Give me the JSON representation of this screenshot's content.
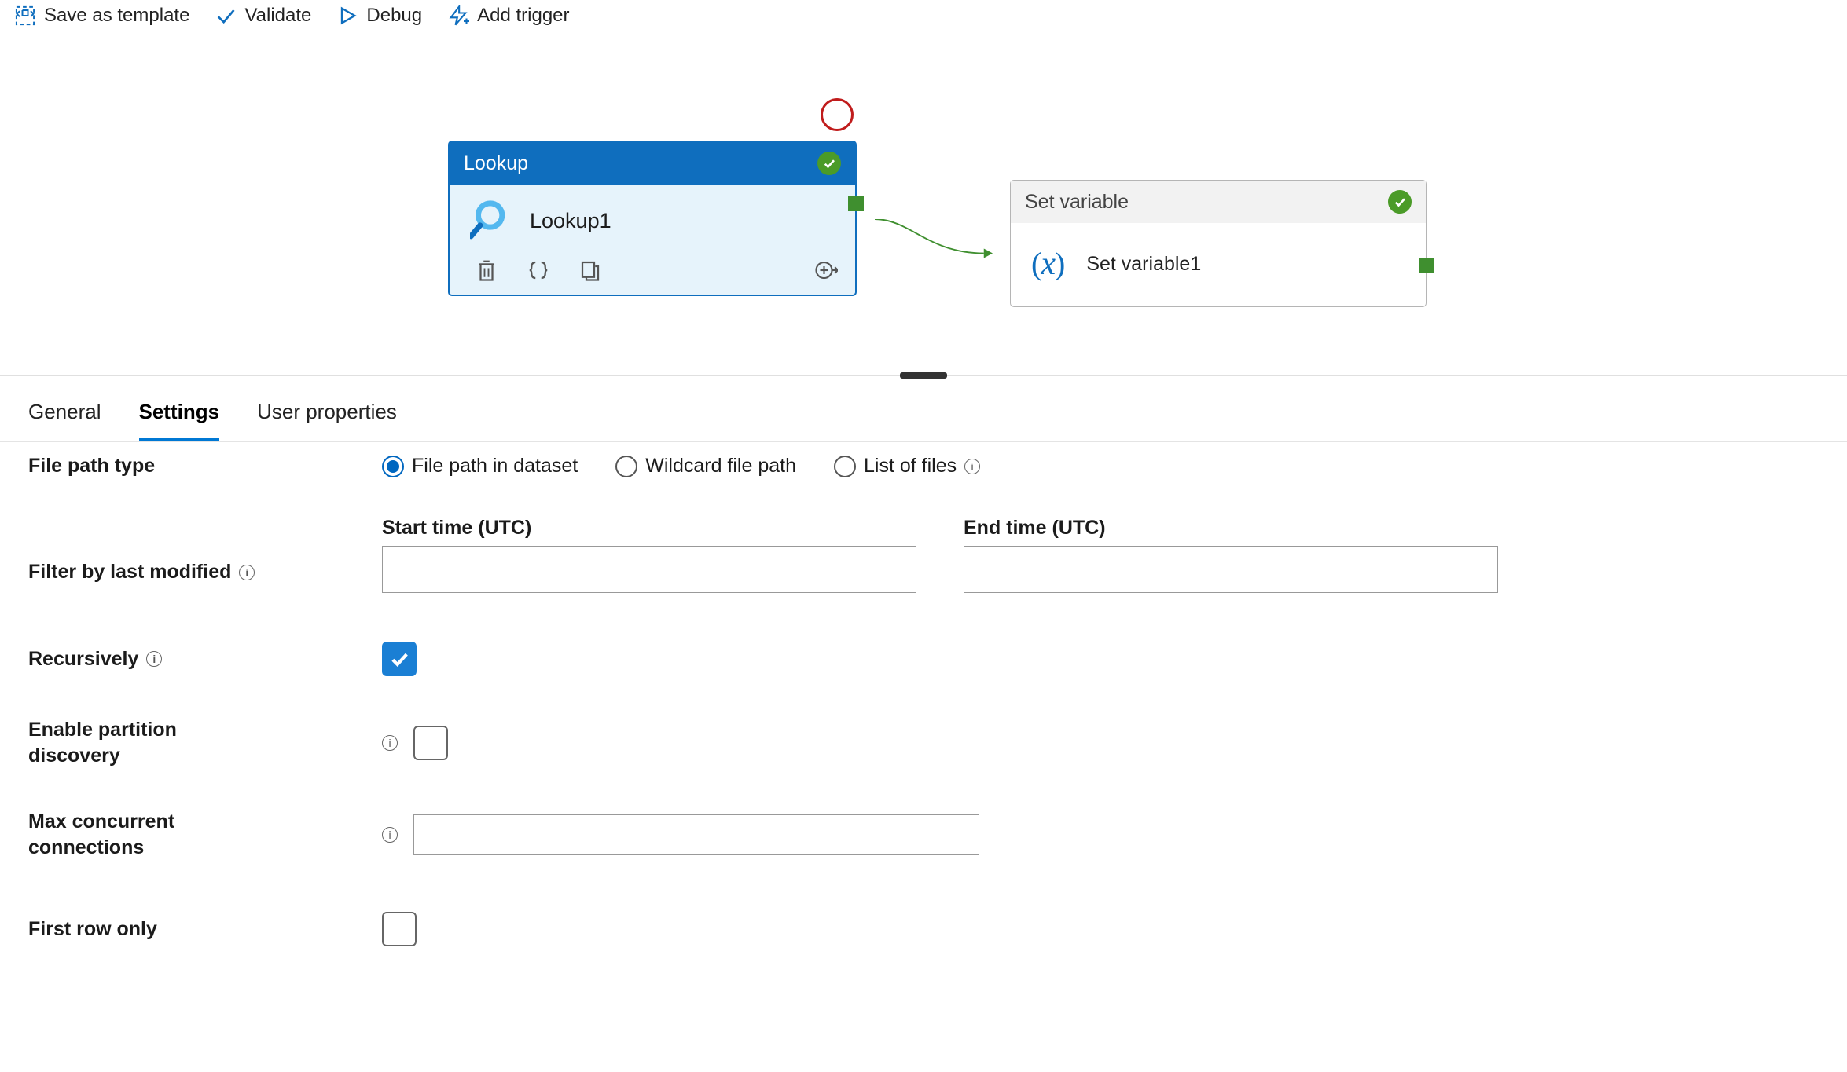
{
  "toolbar": {
    "save_template": "Save as template",
    "validate": "Validate",
    "debug": "Debug",
    "add_trigger": "Add trigger"
  },
  "canvas": {
    "lookup": {
      "type": "Lookup",
      "name": "Lookup1"
    },
    "setvar": {
      "type": "Set variable",
      "name": "Set variable1"
    }
  },
  "tabs": {
    "general": "General",
    "settings": "Settings",
    "user_props": "User properties",
    "active": "settings"
  },
  "settings": {
    "file_path_type": {
      "label": "File path type",
      "options": {
        "in_dataset": "File path in dataset",
        "wildcard": "Wildcard file path",
        "list": "List of files"
      },
      "selected": "in_dataset"
    },
    "filter": {
      "label": "Filter by last modified",
      "start_label": "Start time (UTC)",
      "end_label": "End time (UTC)",
      "start_value": "",
      "end_value": ""
    },
    "recursively": {
      "label": "Recursively",
      "checked": true
    },
    "partition": {
      "label": "Enable partition discovery",
      "checked": false
    },
    "max_conn": {
      "label": "Max concurrent connections",
      "value": ""
    },
    "first_row": {
      "label": "First row only",
      "checked": false
    }
  }
}
